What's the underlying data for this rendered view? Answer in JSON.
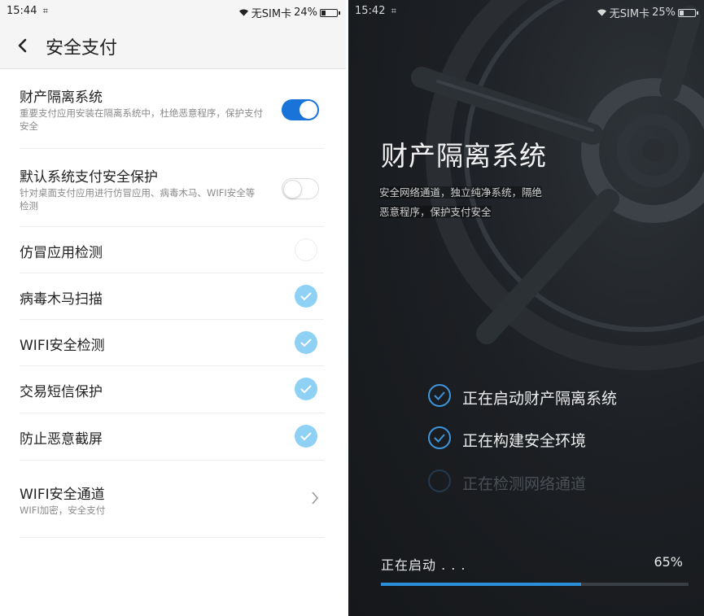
{
  "left": {
    "status_bar": {
      "time": "15:44",
      "sim": "无SIM卡",
      "battery": "24%",
      "battery_level": 0.24
    },
    "header": {
      "title": "安全支付",
      "back_icon": "chevron-left-icon"
    },
    "settings": [
      {
        "title": "财产隔离系统",
        "desc": "重要支付应用安装在隔离系统中，杜绝恶意程序，保护支付安全",
        "control": "toggle",
        "on": true
      },
      {
        "title": "默认系统支付安全保护",
        "desc": "针对桌面支付应用进行仿冒应用、病毒木马、WIFI安全等检测",
        "control": "toggle",
        "on": false
      },
      {
        "title": "仿冒应用检测",
        "control": "check",
        "checked": false
      },
      {
        "title": "病毒木马扫描",
        "control": "check",
        "checked": true
      },
      {
        "title": "WIFI安全检测",
        "control": "check",
        "checked": true
      },
      {
        "title": "交易短信保护",
        "control": "check",
        "checked": true
      },
      {
        "title": "防止恶意截屏",
        "control": "check",
        "checked": true
      },
      {
        "title": "WIFI安全通道",
        "desc": "WIFI加密，安全支付",
        "control": "chevron"
      }
    ]
  },
  "right": {
    "status_bar": {
      "time": "15:42",
      "sim": "无SIM卡",
      "battery": "25%",
      "battery_level": 0.25
    },
    "hero": {
      "title": "财产隔离系统",
      "desc_line1": "安全网络通道，独立纯净系统，隔绝",
      "desc_line2": "恶意程序，保护支付安全"
    },
    "steps": [
      {
        "label": "正在启动财产隔离系统",
        "done": true
      },
      {
        "label": "正在构建安全环境",
        "done": true
      },
      {
        "label": "正在检测网络通道",
        "done": false
      }
    ],
    "progress": {
      "label": "正在启动 . . .",
      "percent_text": "65%",
      "value": 0.65
    }
  },
  "colors": {
    "toggle_on": "#1a73d9",
    "check_on": "#8fd0f5",
    "progress_fill": "#2b8ed9",
    "dark_bg": "#1d2024"
  }
}
